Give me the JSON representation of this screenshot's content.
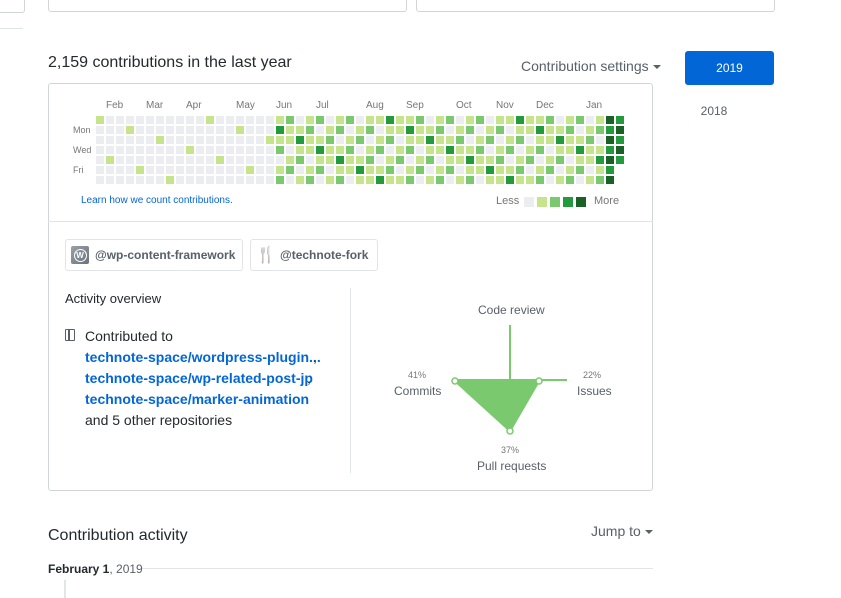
{
  "heading": "2,159 contributions in the last year",
  "settings_label": "Contribution settings",
  "years": [
    "2019",
    "2018"
  ],
  "months": [
    "Feb",
    "Mar",
    "Apr",
    "May",
    "Jun",
    "Jul",
    "Aug",
    "Sep",
    "Oct",
    "Nov",
    "Dec",
    "Jan"
  ],
  "days": [
    "Mon",
    "Wed",
    "Fri"
  ],
  "graph_colors": [
    "#ebedf0",
    "#c6e48b",
    "#7bc96f",
    "#239a3b",
    "#196127"
  ],
  "learn_link": "Learn how we count contributions.",
  "legend": {
    "less": "Less",
    "more": "More"
  },
  "orgs": [
    {
      "name": "@wp-content-framework",
      "icon": "wordpress-avatar"
    },
    {
      "name": "@technote-fork",
      "icon": "fork-knife-icon"
    }
  ],
  "activity": {
    "title": "Activity overview",
    "contributed_to": "Contributed to",
    "repos": [
      "technote-space/wordpress-plugin...",
      "technote-space/wp-related-post-jp",
      "technote-space/marker-animation"
    ],
    "others": "and 5 other repositories"
  },
  "radar": {
    "code_review": {
      "label": "Code review",
      "percent": ""
    },
    "commits": {
      "label": "Commits",
      "percent": "41%"
    },
    "issues": {
      "label": "Issues",
      "percent": "22%"
    },
    "pull_requests": {
      "label": "Pull requests",
      "percent": "37%"
    },
    "color": "#7bc96f"
  },
  "contribution_activity": {
    "title": "Contribution activity",
    "jump_label": "Jump to",
    "date_bold": "February 1",
    "date_rest": ", 2019"
  }
}
